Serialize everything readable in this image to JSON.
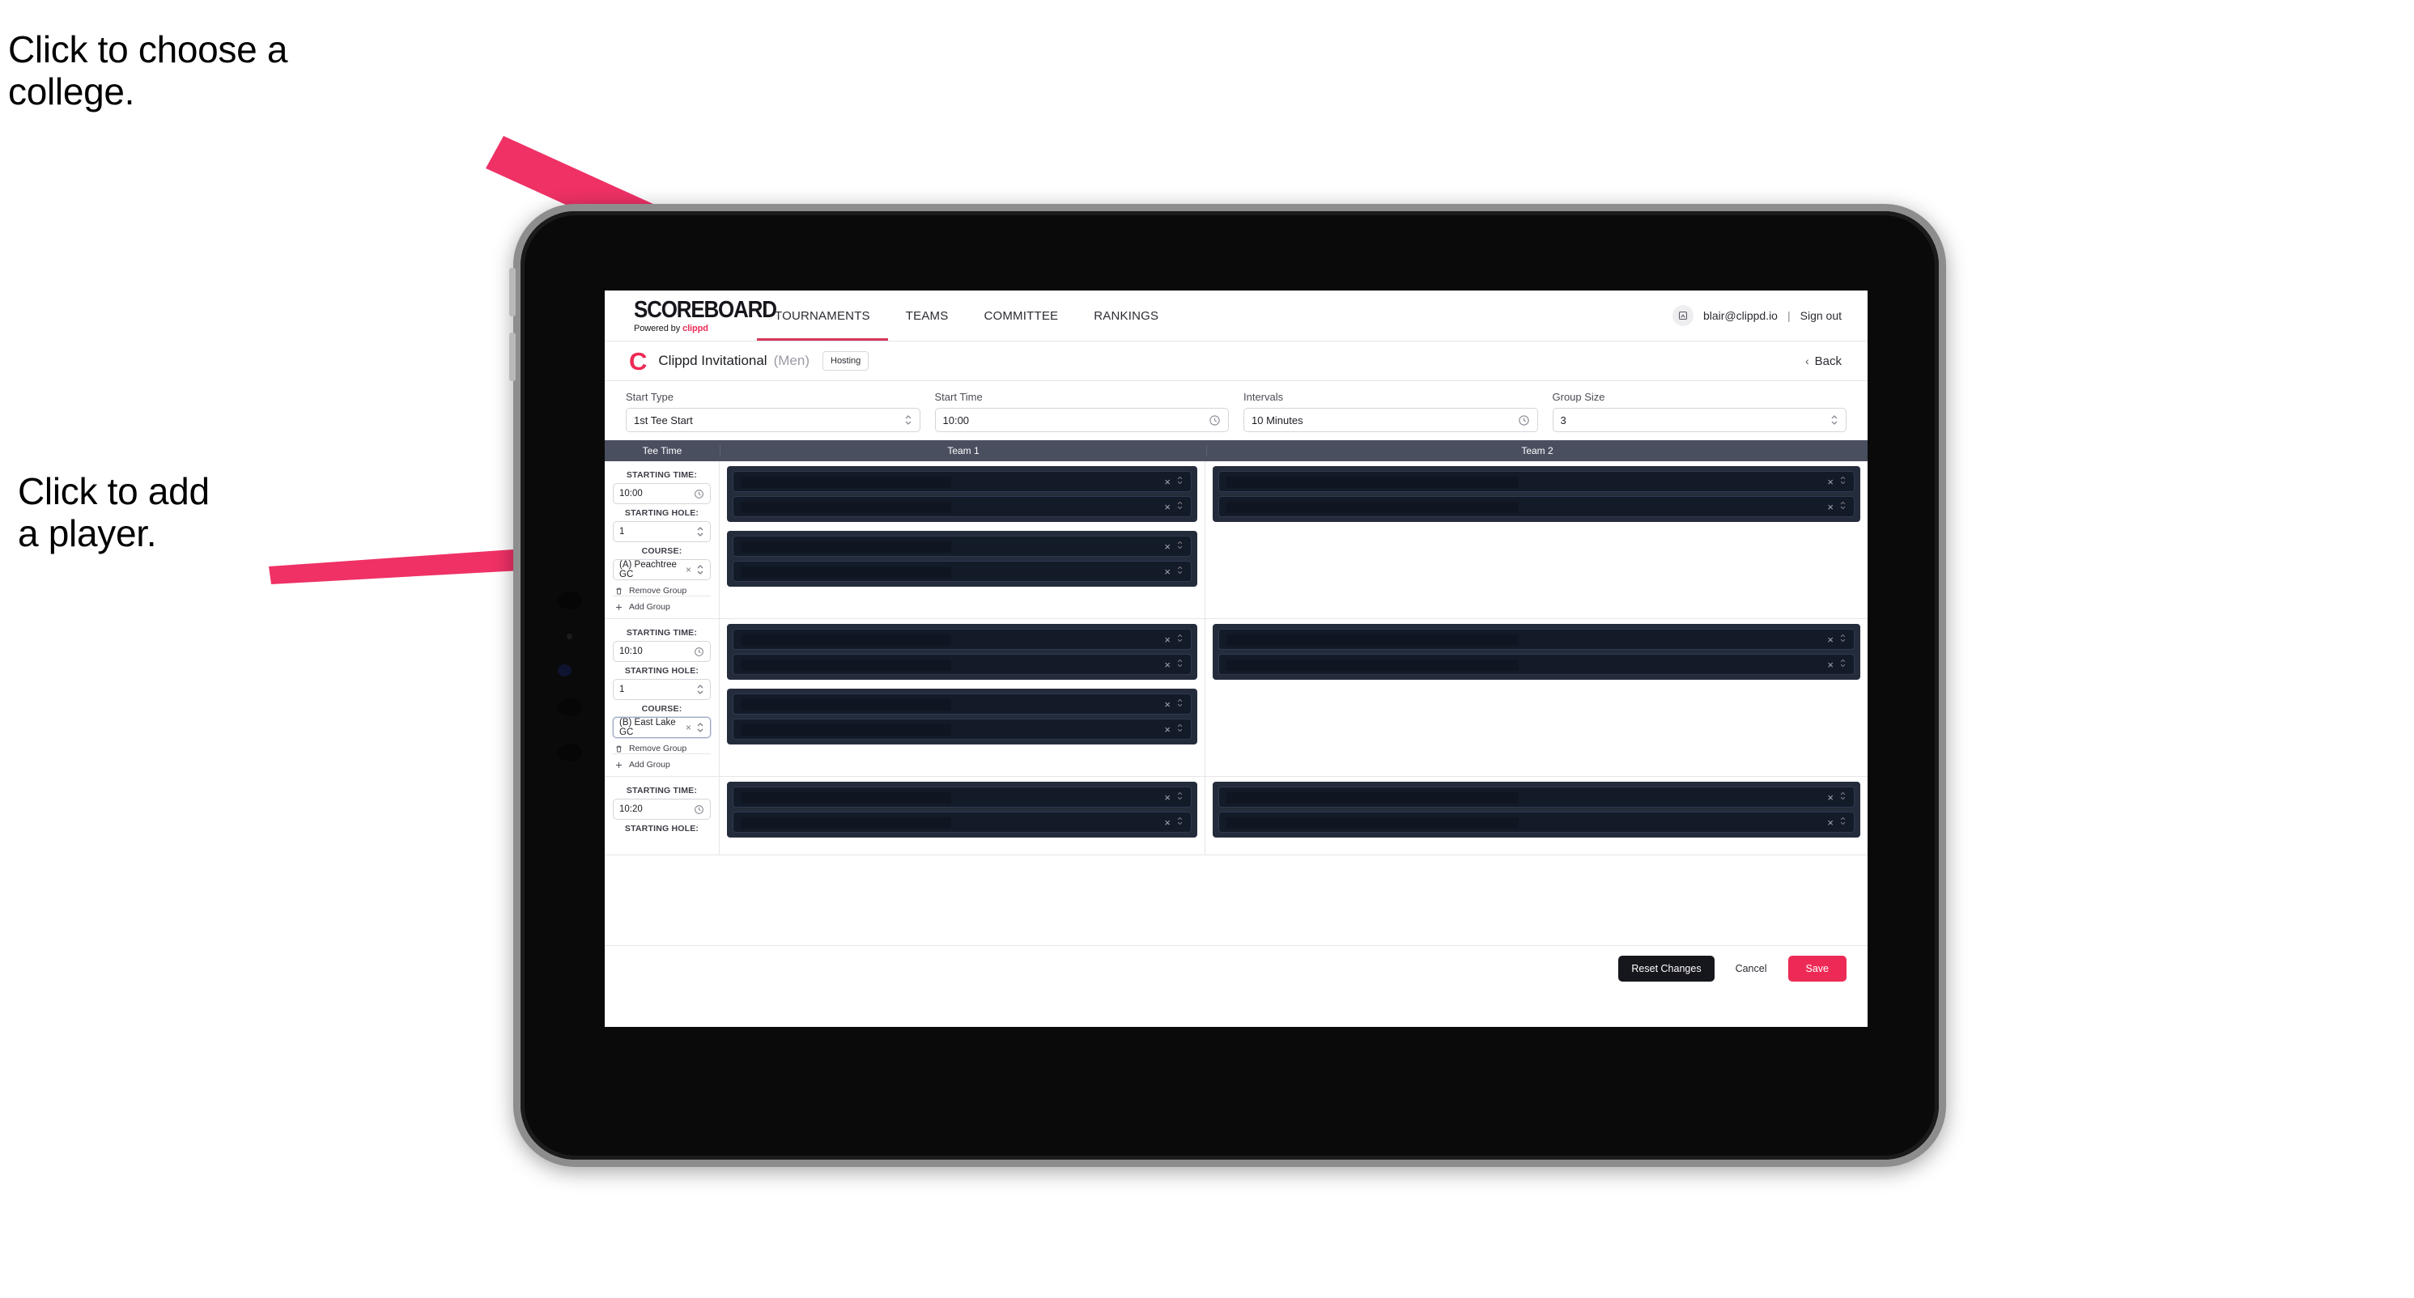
{
  "annotations": [
    {
      "id": "college",
      "text": "Click to choose a\ncollege."
    },
    {
      "id": "player",
      "text": "Click to add\na player."
    }
  ],
  "colors": {
    "accent_pink": "#ed2a55",
    "tab_underline": "#d6365e",
    "table_header_bg": "#4a4f60",
    "slot_panel_bg": "#242c3c",
    "slot_bg": "#141b28",
    "dark_button": "#16161d"
  },
  "navbar": {
    "brand_title": "SCOREBOARD",
    "brand_sub_prefix": "Powered by",
    "brand_sub_name": "clippd",
    "tabs": [
      {
        "label": "TOURNAMENTS",
        "active": true
      },
      {
        "label": "TEAMS",
        "active": false
      },
      {
        "label": "COMMITTEE",
        "active": false
      },
      {
        "label": "RANKINGS",
        "active": false
      }
    ],
    "avatar_icon": "user-icon",
    "user_email": "blair@clippd.io",
    "separator": "|",
    "sign_out": "Sign out"
  },
  "breadcrumb": {
    "logo_letter": "C",
    "tournament_name": "Clippd Invitational",
    "gender": "(Men)",
    "hosting_badge": "Hosting",
    "back_chevron": "‹",
    "back_label": "Back"
  },
  "controls": [
    {
      "label": "Start Type",
      "value": "1st Tee Start",
      "icon": "stepper-icon"
    },
    {
      "label": "Start Time",
      "value": "10:00",
      "icon": "clock-icon"
    },
    {
      "label": "Intervals",
      "value": "10 Minutes",
      "icon": "clock-icon"
    },
    {
      "label": "Group Size",
      "value": "3",
      "icon": "stepper-icon"
    }
  ],
  "table": {
    "headers": [
      "Tee Time",
      "Team 1",
      "Team 2"
    ],
    "field_labels": {
      "starting_time": "STARTING TIME:",
      "starting_hole": "STARTING HOLE:",
      "course": "COURSE:"
    },
    "group_actions": {
      "remove": "Remove Group",
      "add": "Add Group"
    },
    "groups": [
      {
        "starting_time": "10:00",
        "starting_hole": "1",
        "course": "(A) Peachtree GC",
        "course_focused": false,
        "team1_blocks": 2,
        "team2_blocks": 1,
        "slots_per_block": 2,
        "partial": false
      },
      {
        "starting_time": "10:10",
        "starting_hole": "1",
        "course": "(B) East Lake GC",
        "course_focused": true,
        "team1_blocks": 2,
        "team2_blocks": 1,
        "slots_per_block": 2,
        "partial": false
      },
      {
        "starting_time": "10:20",
        "starting_hole": "",
        "course": "",
        "course_focused": false,
        "team1_blocks": 1,
        "team2_blocks": 1,
        "slots_per_block": 2,
        "partial": true
      }
    ]
  },
  "footer": {
    "reset": "Reset Changes",
    "cancel": "Cancel",
    "save": "Save"
  }
}
